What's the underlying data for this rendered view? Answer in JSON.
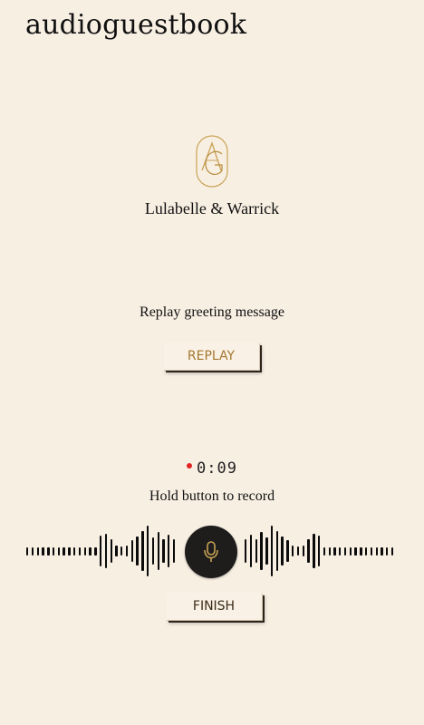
{
  "app": {
    "brand": "audioguestbook"
  },
  "event": {
    "couple_names": "Lulabelle & Warrick"
  },
  "greeting": {
    "label": "Replay greeting message",
    "replay_button": "REPLAY"
  },
  "recorder": {
    "timer": "0:09",
    "recording": true,
    "hint": "Hold button to record",
    "finish_button": "FINISH"
  },
  "colors": {
    "background": "#f8efe3",
    "gold_accent": "#c9a355",
    "record_dot": "#e02424",
    "mic_button": "#1e1d1c"
  },
  "icons": {
    "monogram": "monogram-logo",
    "mic": "microphone-icon",
    "recording": "record-dot-icon"
  }
}
